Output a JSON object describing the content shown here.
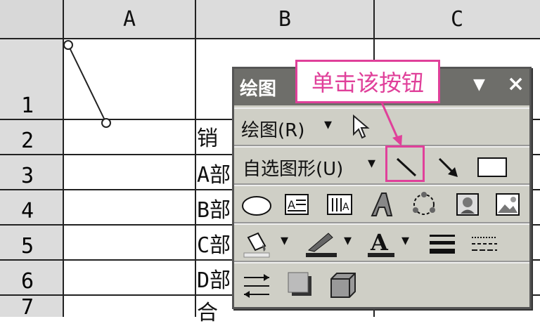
{
  "columns": [
    "A",
    "B",
    "C"
  ],
  "rows": [
    "1",
    "2",
    "3",
    "4",
    "5",
    "6",
    "7"
  ],
  "cells": {
    "b2": "销",
    "b3": "A部",
    "b4": "B部",
    "b5": "C部",
    "b6": "D部",
    "b7": "合"
  },
  "toolbar": {
    "title": "绘图",
    "draw_menu": "绘图(R)",
    "autoshapes_menu": "自选图形(U)",
    "close_glyph": "×",
    "dropdown_glyph": "▼",
    "small_arrow": "▾"
  },
  "callout": {
    "text": "单击该按钮"
  },
  "colors": {
    "callout": "#e0409a",
    "titlebar": "#6e6e6a",
    "toolbar_bg": "#cfcfc6"
  }
}
